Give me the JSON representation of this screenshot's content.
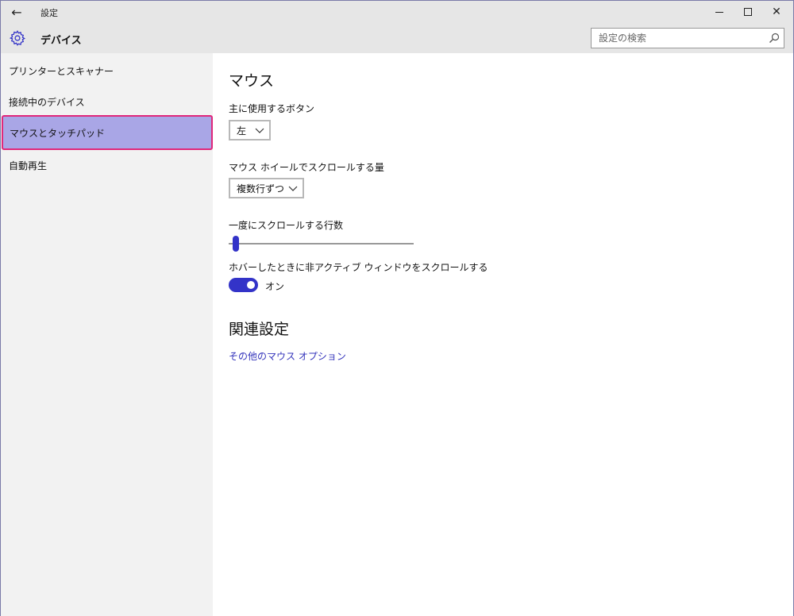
{
  "window": {
    "title": "設定",
    "back_icon": "arrow-left-icon",
    "min_icon": "minimize-icon",
    "max_icon": "maximize-icon",
    "close_icon": "close-icon"
  },
  "header": {
    "icon": "gear-icon",
    "title": "デバイス",
    "search_placeholder": "設定の検索",
    "search_icon": "search-icon"
  },
  "sidebar": {
    "items": [
      {
        "label": "プリンターとスキャナー",
        "selected": false
      },
      {
        "label": "接続中のデバイス",
        "selected": false
      },
      {
        "label": "マウスとタッチパッド",
        "selected": true
      },
      {
        "label": "自動再生",
        "selected": false
      }
    ]
  },
  "main": {
    "section_title": "マウス",
    "primary_button_label": "主に使用するボタン",
    "primary_button_value": "左",
    "wheel_label": "マウス ホイールでスクロールする量",
    "wheel_value": "複数行ずつ",
    "lines_label": "一度にスクロールする行数",
    "lines_slider_fraction": 0.02,
    "hover_scroll_label": "ホバーしたときに非アクティブ ウィンドウをスクロールする",
    "hover_scroll_state": "オン",
    "related_title": "関連設定",
    "related_link": "その他のマウス オプション"
  },
  "colors": {
    "accent": "#3333c8",
    "selected_bg": "#a9a6e6",
    "selected_border": "#e0287a",
    "chrome_bg": "#e6e6e6",
    "sidebar_bg": "#f2f2f2",
    "link": "#3333bb"
  }
}
